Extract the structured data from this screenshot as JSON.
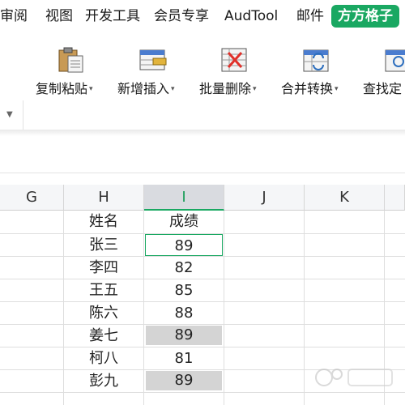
{
  "menu": {
    "tabs": [
      {
        "label": "审阅",
        "active": false
      },
      {
        "label": "视图",
        "active": false
      },
      {
        "label": "开发工具",
        "active": false
      },
      {
        "label": "会员专享",
        "active": false
      },
      {
        "label": "AudTool",
        "active": false
      },
      {
        "label": "邮件",
        "active": false
      },
      {
        "label": "方方格子",
        "active": true
      }
    ],
    "active_color": "#1aa862"
  },
  "ribbon": {
    "tools": [
      {
        "label": "复制粘贴",
        "icon": "copy-paste-icon"
      },
      {
        "label": "新增插入",
        "icon": "insert-icon"
      },
      {
        "label": "批量删除",
        "icon": "batch-delete-icon"
      },
      {
        "label": "合并转换",
        "icon": "merge-convert-icon"
      },
      {
        "label": "查找定",
        "icon": "find-locate-icon"
      }
    ]
  },
  "sheet": {
    "columns": [
      "G",
      "H",
      "I",
      "J",
      "K"
    ],
    "selected_column": "I",
    "header_row": {
      "name": "姓名",
      "score": "成绩"
    },
    "rows": [
      {
        "name": "张三",
        "score": "89",
        "highlight": "active"
      },
      {
        "name": "李四",
        "score": "82",
        "highlight": "none"
      },
      {
        "name": "王五",
        "score": "85",
        "highlight": "none"
      },
      {
        "name": "陈六",
        "score": "88",
        "highlight": "none"
      },
      {
        "name": "姜七",
        "score": "89",
        "highlight": "shaded"
      },
      {
        "name": "柯八",
        "score": "81",
        "highlight": "none"
      },
      {
        "name": "彭九",
        "score": "89",
        "highlight": "shaded"
      }
    ]
  }
}
